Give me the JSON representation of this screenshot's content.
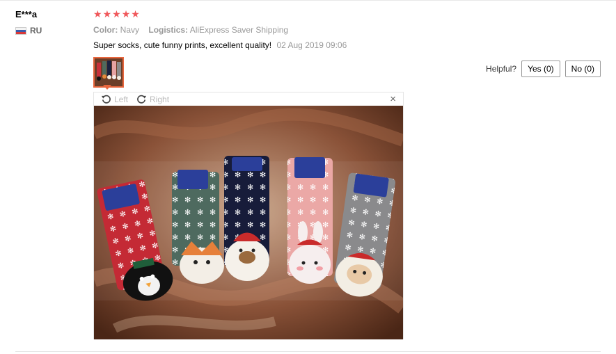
{
  "review": {
    "user": "E***a",
    "country": "RU",
    "rating": 5,
    "color_label": "Color:",
    "color_value": "Navy",
    "logistics_label": "Logistics:",
    "logistics_value": "AliExpress Saver Shipping",
    "text": "Super socks, cute funny prints, excellent quality!",
    "date": "02 Aug 2019 09:06"
  },
  "helpful": {
    "label": "Helpful?",
    "yes": "Yes (0)",
    "no": "No (0)"
  },
  "viewer": {
    "rotate_left": "Left",
    "rotate_right": "Right",
    "close": "×"
  },
  "colors": {
    "star": "#f0575a",
    "thumb_border": "#e8663d"
  },
  "icons": [
    "rotate-left-icon",
    "rotate-right-icon",
    "close-icon",
    "star-icon",
    "flag-ru-icon"
  ]
}
